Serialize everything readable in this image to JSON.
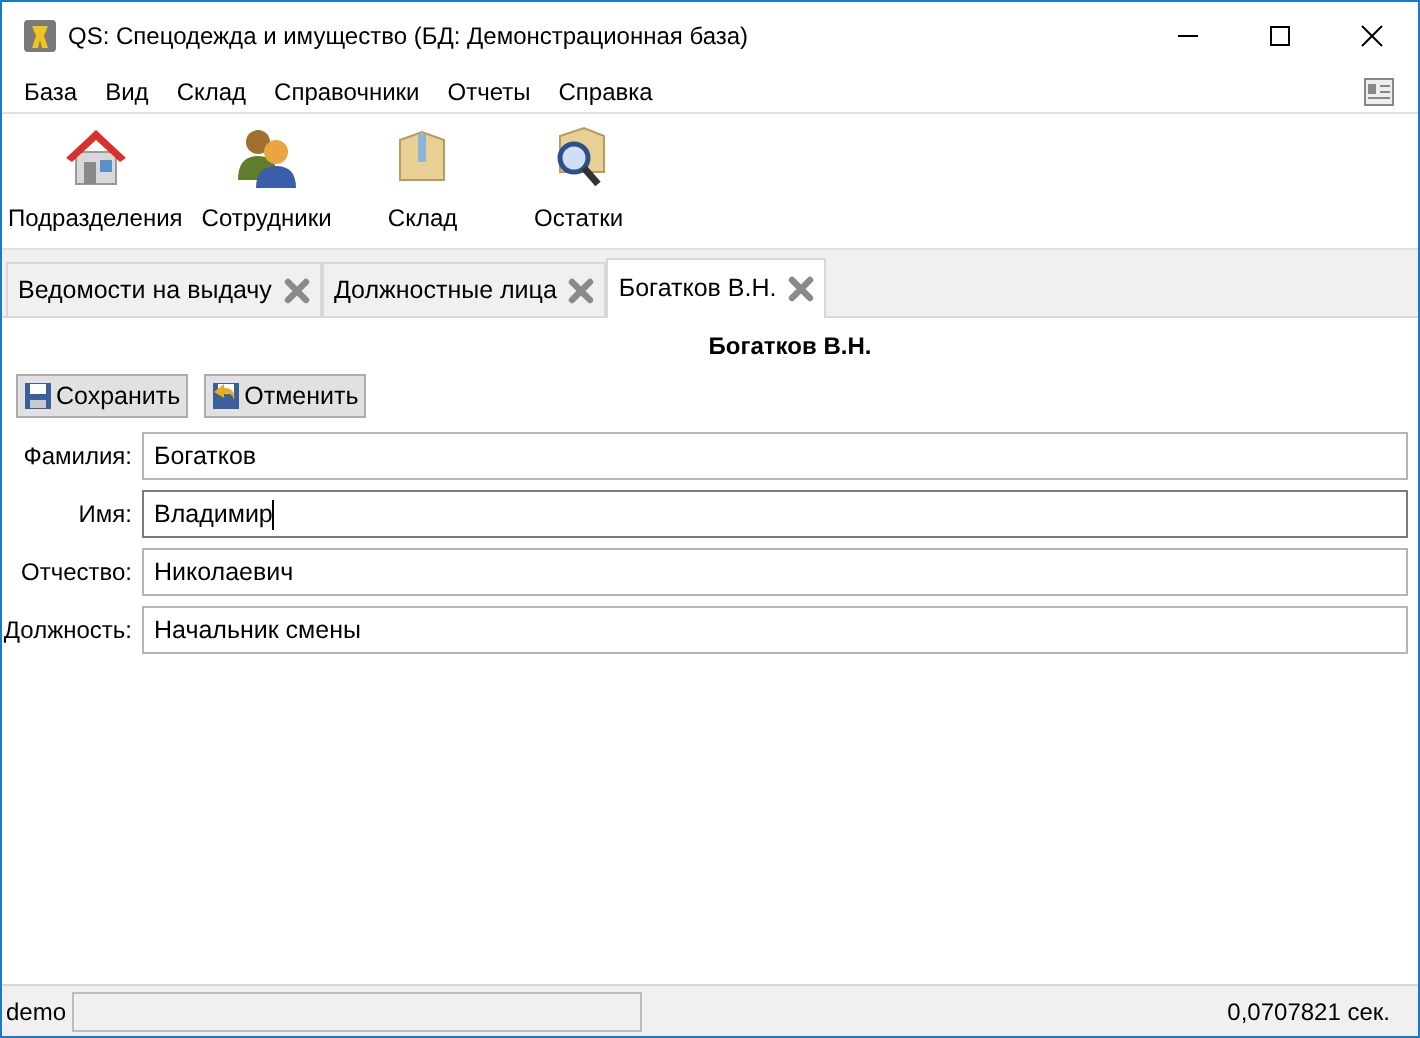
{
  "window": {
    "title": "QS: Спецодежда и имущество (БД: Демонстрационная база)"
  },
  "menu": [
    "База",
    "Вид",
    "Склад",
    "Справочники",
    "Отчеты",
    "Справка"
  ],
  "toolbar": [
    {
      "kind": "house",
      "label": "Подразделения"
    },
    {
      "kind": "people",
      "label": "Сотрудники"
    },
    {
      "kind": "box",
      "label": "Склад"
    },
    {
      "kind": "search",
      "label": "Остатки"
    }
  ],
  "tabs": [
    {
      "label": "Ведомости на выдачу",
      "selected": false
    },
    {
      "label": "Должностные лица",
      "selected": false
    },
    {
      "label": "Богатков В.Н.",
      "selected": true
    }
  ],
  "form": {
    "title": "Богатков В.Н.",
    "buttons": [
      {
        "kind": "save",
        "label": "Сохранить"
      },
      {
        "kind": "cancel",
        "label": "Отменить"
      }
    ],
    "fields": [
      {
        "label": "Фамилия:",
        "value": "Богатков",
        "focused": false
      },
      {
        "label": "Имя:",
        "value": "Владимир",
        "focused": true
      },
      {
        "label": "Отчество:",
        "value": "Николаевич",
        "focused": false
      },
      {
        "label": "Должность:",
        "value": "Начальник смены",
        "focused": false
      }
    ]
  },
  "status_bar": {
    "user": "demo",
    "time": "0,0707821 сек."
  }
}
